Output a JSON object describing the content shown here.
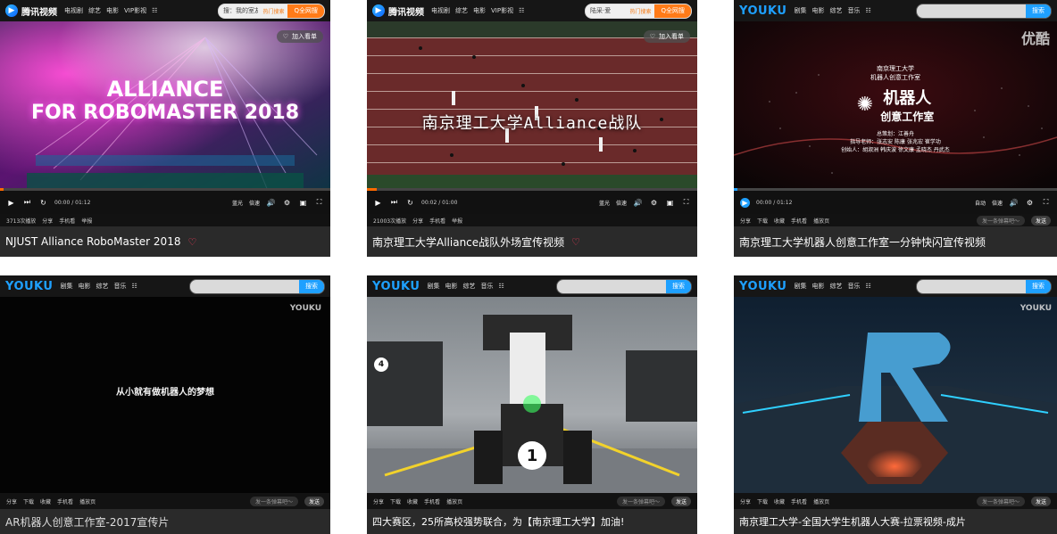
{
  "tiles": [
    {
      "platform": "tencent",
      "logo_text": "腾讯视频",
      "nav": [
        "电视剧",
        "综艺",
        "电影",
        "VIP影视",
        "☷"
      ],
      "search_value": "搜：我的室友叫不二…",
      "search_hint": "热门搜索",
      "search_btn": "Q全网搜",
      "overlay_text_1": "ALLIANCE",
      "overlay_text_2": "FOR ROBOMASTER 2018",
      "add_list": "加入看单",
      "time": "00:00 / 01:12",
      "quality": "蓝光",
      "speed": "倍速",
      "meta_left": [
        "3713次播放",
        "分享",
        "手机看",
        "举报"
      ],
      "caption": "NJUST Alliance RoboMaster 2018"
    },
    {
      "platform": "tencent",
      "logo_text": "腾讯视频",
      "nav": [
        "电视剧",
        "综艺",
        "电影",
        "VIP影视",
        "☷"
      ],
      "search_value": "陆采·爱",
      "search_hint": "热门搜索",
      "search_btn": "Q全网搜",
      "overlay_text_1": "南京理工大学Alliance战队",
      "add_list": "加入看单",
      "time": "00:02 / 01:00",
      "quality": "蓝光",
      "speed": "倍速",
      "meta_left": [
        "21003次播放",
        "分享",
        "手机看",
        "举报"
      ],
      "caption": "南京理工大学Alliance战队外场宣传视频"
    },
    {
      "platform": "youku",
      "logo_text": "YOUKU",
      "nav": [
        "剧集",
        "电影",
        "综艺",
        "音乐",
        "☷"
      ],
      "search_btn": "搜索",
      "watermark": "优酷",
      "overlay_title_1": "南京理工大学",
      "overlay_title_2": "机器人创意工作室",
      "overlay_main": "机器人",
      "overlay_sub": "创意工作室",
      "overlay_names": "总策划：江善舟",
      "overlay_names_2": "指导老师：张志安 陈康 张兆宏 崔学功",
      "overlay_names_3": "创始人：胡淑洲 韩庆波 徐文康 孟晓杰 丹武杰",
      "time": "00:00 / 01:12",
      "quality": "自动",
      "speed": "倍速",
      "meta_left": [
        "分享",
        "下载",
        "收藏",
        "手机看",
        "播放页"
      ],
      "danmu_placeholder": "发一条弹幕吧～",
      "send": "发送",
      "caption": "南京理工大学机器人创意工作室一分钟快闪宣传视频"
    },
    {
      "platform": "youku",
      "logo_text": "YOUKU",
      "nav": [
        "剧集",
        "电影",
        "综艺",
        "音乐",
        "☷"
      ],
      "search_btn": "搜索",
      "watermark": "YOUKU",
      "center_text": "从小就有做机器人的梦想",
      "meta_left": [
        "分享",
        "下载",
        "收藏",
        "手机看",
        "播放页"
      ],
      "danmu_placeholder": "发一条弹幕吧～",
      "send": "发送",
      "caption": "AR机器人创意工作室-2017宣传片"
    },
    {
      "platform": "youku",
      "logo_text": "YOUKU",
      "nav": [
        "剧集",
        "电影",
        "综艺",
        "音乐",
        "☷"
      ],
      "search_btn": "搜索",
      "watermark": "",
      "robot_number_main": "1",
      "robot_number_side": "4",
      "meta_left": [
        "分享",
        "下载",
        "收藏",
        "手机看",
        "播放页"
      ],
      "danmu_placeholder": "发一条弹幕吧～",
      "send": "发送",
      "caption": "四大赛区，25所高校强势联合，为【南京理工大学】加油!"
    },
    {
      "platform": "youku",
      "logo_text": "YOUKU",
      "nav": [
        "剧集",
        "电影",
        "综艺",
        "音乐",
        "☷"
      ],
      "search_btn": "搜索",
      "watermark": "YOUKU",
      "meta_left": [
        "分享",
        "下载",
        "收藏",
        "手机看",
        "播放页"
      ],
      "danmu_placeholder": "发一条弹幕吧～",
      "send": "发送",
      "caption": "南京理工大学-全国大学生机器人大赛-拉票视频-成片"
    }
  ],
  "colors": {
    "tencent_orange": "#ff7b18",
    "youku_blue": "#1ea0ff",
    "heart": "#ff3b5c"
  }
}
